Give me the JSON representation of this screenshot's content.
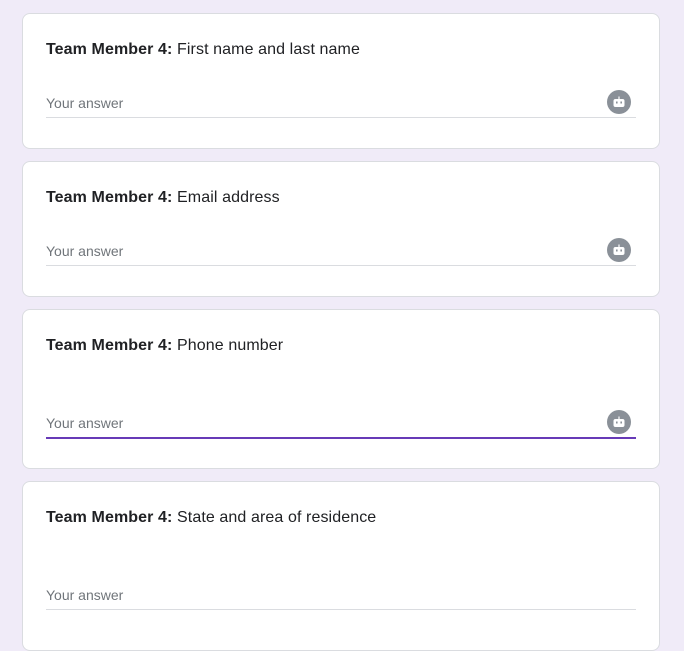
{
  "questions": [
    {
      "prefix": "Team Member 4:",
      "title": " First name and last name",
      "placeholder": "Your answer",
      "value": "",
      "focused": false,
      "has_assistant_icon": true
    },
    {
      "prefix": "Team Member 4:",
      "title": " Email address",
      "placeholder": "Your answer",
      "value": "",
      "focused": false,
      "has_assistant_icon": true
    },
    {
      "prefix": "Team Member 4:",
      "title": " Phone number",
      "placeholder": "Your answer",
      "value": "",
      "focused": true,
      "has_assistant_icon": true
    },
    {
      "prefix": "Team Member 4:",
      "title": " State and area of residence",
      "placeholder": "Your answer",
      "value": "",
      "focused": false,
      "has_assistant_icon": false
    }
  ],
  "icons": {
    "assistant": "robot-icon"
  },
  "colors": {
    "background": "#f0ebf8",
    "focus_accent": "#673ab7",
    "assistant_icon_bg": "#8a9098"
  }
}
